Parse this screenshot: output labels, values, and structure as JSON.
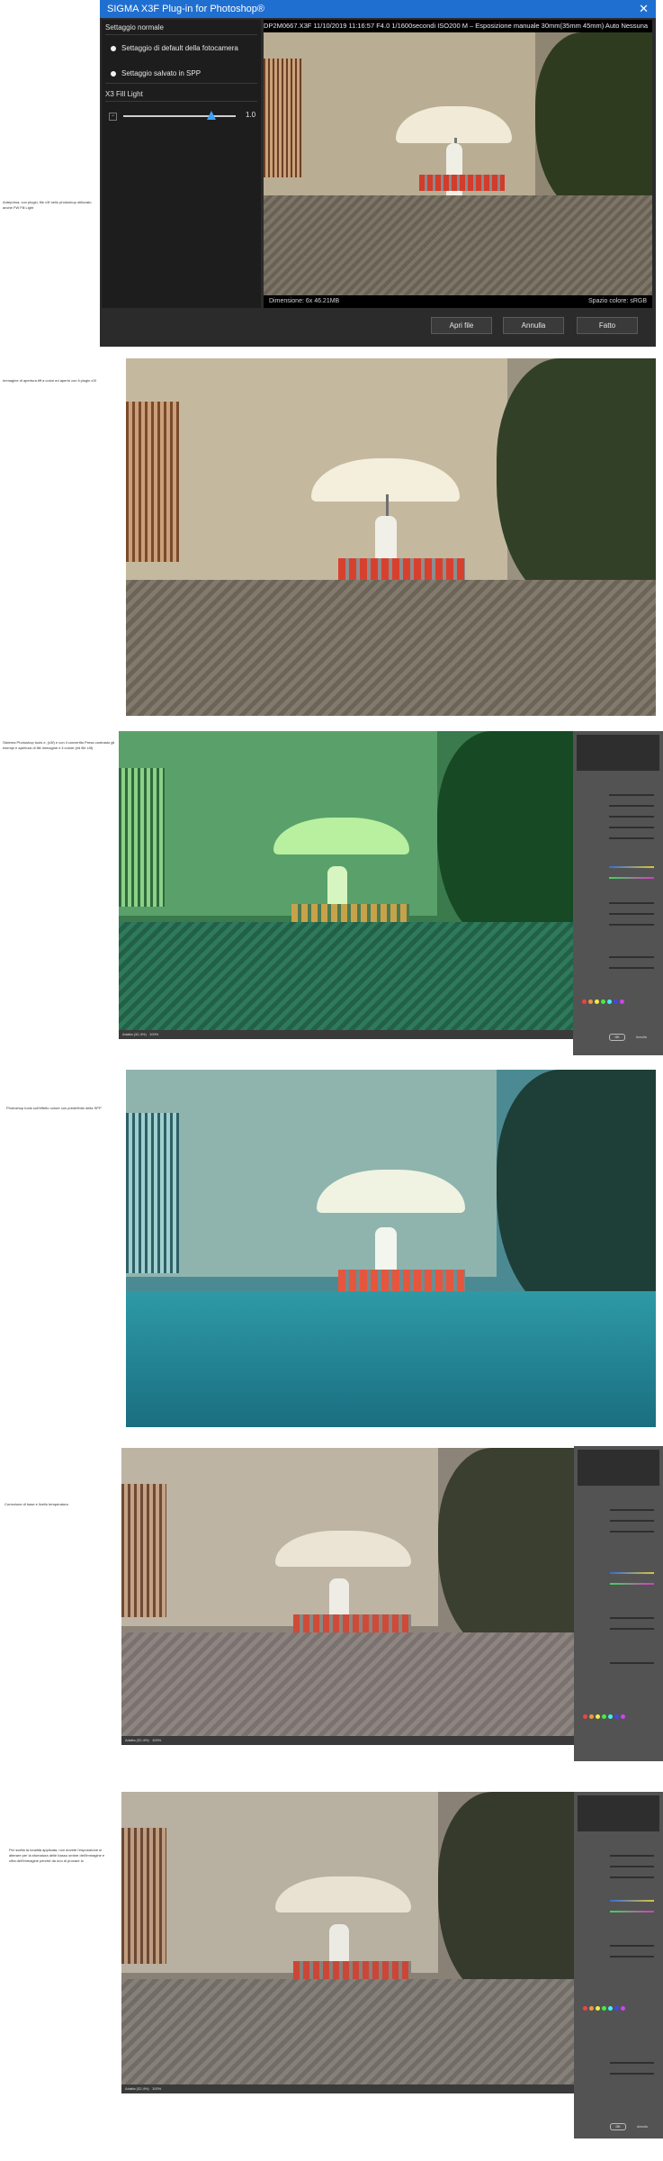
{
  "plugin": {
    "title": "SIGMA X3F Plug-in for Photoshop®",
    "section_label": "Settaggio normale",
    "option_1": "Settaggio di default della fotocamera",
    "option_2": "Settaggio salvato in SPP",
    "fill_light_label": "X3 Fill Light",
    "fill_light_value": "1.0",
    "fill_light_fraction": 0.78,
    "info_bar": "DP2M0667.X3F   11/10/2019 11:16:57 F4.0 1/1600secondi ISO200 M  – Esposizione manuale 30mm(35mm 45mm) Auto  Nessuna",
    "dimension_text": "Dimensione: 6x 46.21MB",
    "color_space_text": "Spazio colore: sRGB",
    "buttons": [
      "Apri file",
      "Annulla",
      "Fatto"
    ]
  },
  "captions": [
    "Anteprima, con plugin, file x3f nello photoshop utilizzato anche FW Fill Light",
    "Immagine di apertura tiff a colori ed aperto con il plugin x3f",
    "Sistema Photoshop tools e, (x3f) e con il convertito Presa contrasto gli esempi e apertura di file immagine e il colore (ed file x3f)",
    "Photoshop tools sull'effetto colore con predefinito della SPP",
    "Correzione di base e livello temperatura",
    "Per scelta la tonalità applicata, non dovete l'esposizione si alterare per la sfumatura delle basso ombre dell'immagine e cifra dell'immagine perché da uno di provare lo"
  ],
  "acr": {
    "zoom_label": "Adatta (32,4%)",
    "zoom_value": "100%",
    "ok": "OK",
    "cancel": "Annulla"
  }
}
